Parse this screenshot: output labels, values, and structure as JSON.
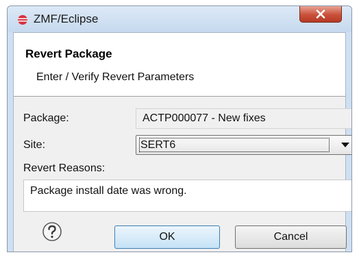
{
  "window": {
    "title": "ZMF/Eclipse"
  },
  "dialog": {
    "title": "Revert Package",
    "subtitle": "Enter / Verify Revert Parameters"
  },
  "form": {
    "package_label": "Package:",
    "package_value": "ACTP000077 - New fixes",
    "site_label": "Site:",
    "site_value": "SERT6",
    "reasons_label": "Revert Reasons:",
    "reasons_value": "Package install date was wrong."
  },
  "buttons": {
    "ok_label": "OK",
    "cancel_label": "Cancel"
  },
  "icons": {
    "app": "eclipse-icon",
    "close": "close-icon",
    "help": "help-icon",
    "dropdown": "chevron-down-icon"
  },
  "colors": {
    "titlebar": "#c6d9ee",
    "close_button": "#c9503a",
    "ok_border": "#3c7fb1"
  }
}
